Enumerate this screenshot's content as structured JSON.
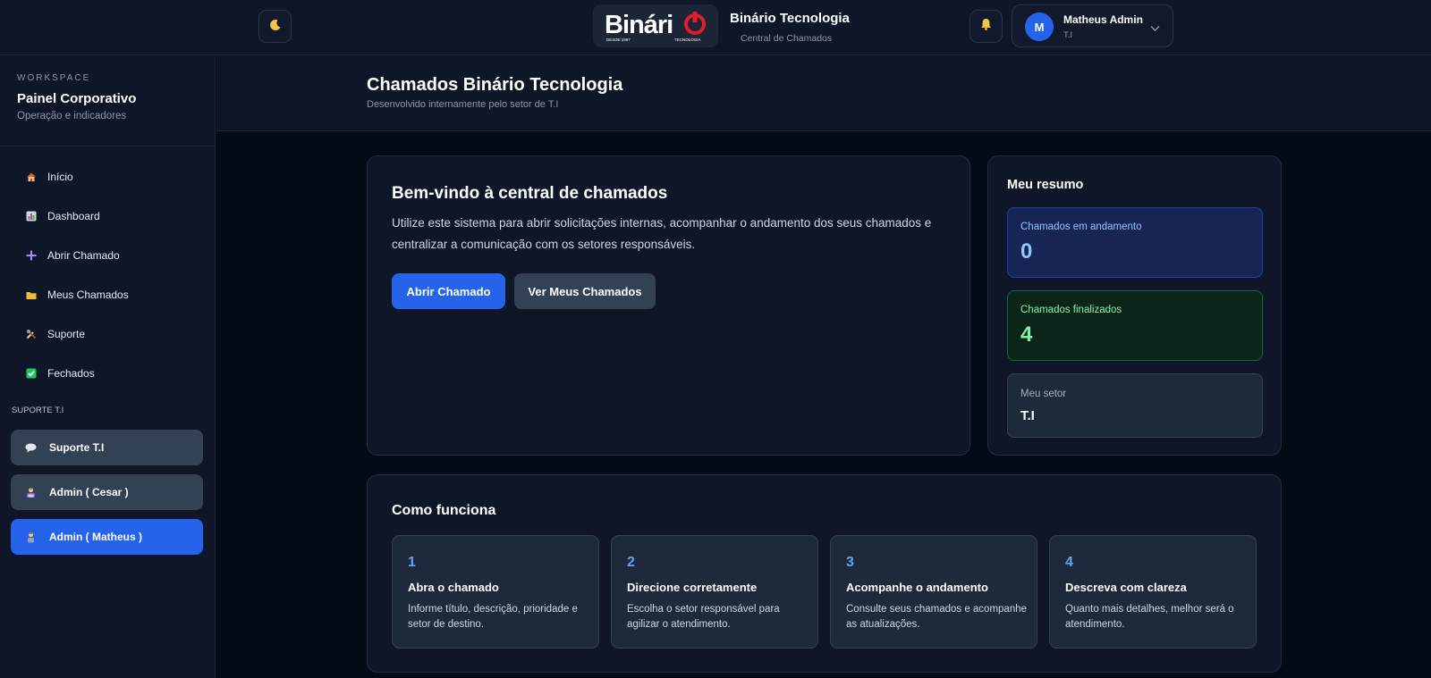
{
  "header": {
    "brand_title": "Binário Tecnologia",
    "brand_subtitle": "Central de Chamados",
    "logo_text": "Binári",
    "logo_since": "DESDE 1997",
    "logo_tag": "TECNOLOGIA",
    "theme_icon": "moon-icon",
    "notification_icon": "bell-icon",
    "user": {
      "initial": "M",
      "name": "Matheus Admin",
      "role": "T.I"
    }
  },
  "sidebar": {
    "kicker": "WORKSPACE",
    "title": "Painel Corporativo",
    "subtitle": "Operação e indicadores",
    "items": [
      {
        "label": "Início",
        "icon": "house-icon"
      },
      {
        "label": "Dashboard",
        "icon": "bar-chart-icon"
      },
      {
        "label": "Abrir Chamado",
        "icon": "plus-icon"
      },
      {
        "label": "Meus Chamados",
        "icon": "folder-icon"
      },
      {
        "label": "Suporte",
        "icon": "tools-icon"
      },
      {
        "label": "Fechados",
        "icon": "check-box-icon"
      }
    ],
    "support_heading": "SUPORTE T.I",
    "support_items": [
      {
        "label": "Suporte T.I",
        "icon": "speech-bubble-icon"
      },
      {
        "label": "Admin ( Cesar )",
        "icon": "technician-icon"
      },
      {
        "label": "Admin ( Matheus )",
        "icon": "person-icon"
      }
    ]
  },
  "page": {
    "title": "Chamados Binário Tecnologia",
    "subtitle": "Desenvolvido internamente pelo setor de T.I"
  },
  "welcome": {
    "title": "Bem-vindo à central de chamados",
    "text": "Utilize este sistema para abrir solicitações internas, acompanhar o andamento dos seus chamados e centralizar a comunicação com os setores responsáveis.",
    "primary_button": "Abrir Chamado",
    "secondary_button": "Ver Meus Chamados"
  },
  "summary": {
    "title": "Meu resumo",
    "in_progress_label": "Chamados em andamento",
    "in_progress_value": "0",
    "finished_label": "Chamados finalizados",
    "finished_value": "4",
    "sector_label": "Meu setor",
    "sector_value": "T.I"
  },
  "how": {
    "title": "Como funciona",
    "steps": [
      {
        "num": "1",
        "title": "Abra o chamado",
        "desc": "Informe título, descrição, prioridade e setor de destino."
      },
      {
        "num": "2",
        "title": "Direcione corretamente",
        "desc": "Escolha o setor responsável para agilizar o atendimento."
      },
      {
        "num": "3",
        "title": "Acompanhe o andamento",
        "desc": "Consulte seus chamados e acompanhe as atualizações."
      },
      {
        "num": "4",
        "title": "Descreva com clareza",
        "desc": "Quanto mais detalhes, melhor será o atendimento."
      }
    ]
  },
  "colors": {
    "accent": "#2563eb",
    "background": "#050a18",
    "panel": "#0e1628",
    "logo_red": "#e11d2a"
  }
}
